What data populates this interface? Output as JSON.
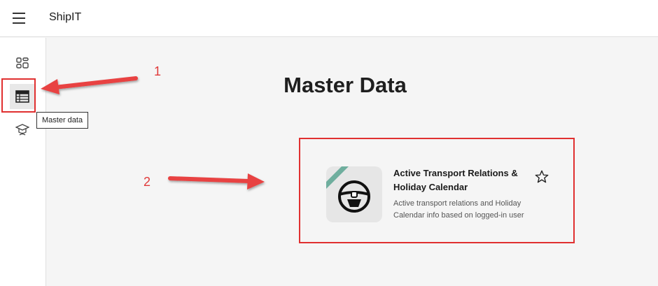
{
  "header": {
    "app_title": "ShipIT"
  },
  "sidebar": {
    "items": [
      {
        "icon": "apps-icon"
      },
      {
        "icon": "table-list-icon",
        "active": true
      },
      {
        "icon": "graduation-cap-icon"
      }
    ],
    "tooltip": "Master data"
  },
  "main": {
    "title": "Master Data",
    "tile": {
      "title": "Active Transport Relations & Holiday Calendar",
      "description": "Active transport relations and Holiday Calendar info based on logged-in user",
      "favorite_icon": "star-icon",
      "app_icon": "steering-wheel-icon"
    }
  },
  "annotations": {
    "marker_1": "1",
    "marker_2": "2",
    "color": "#e03a3a"
  }
}
